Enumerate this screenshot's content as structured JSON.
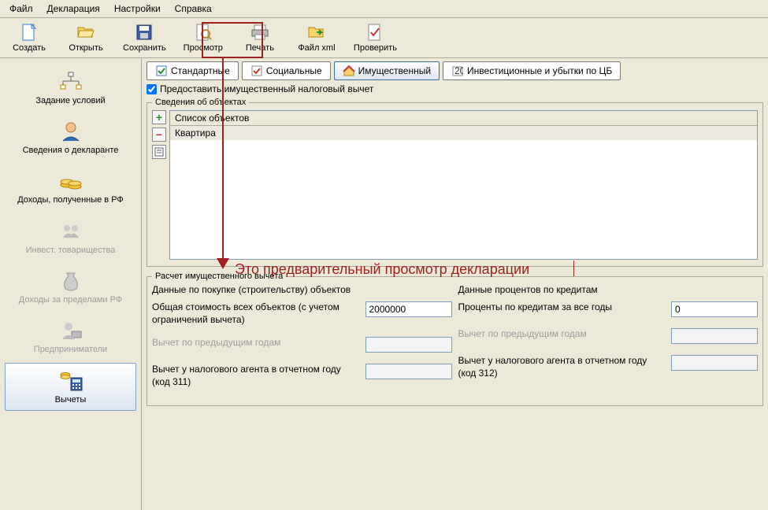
{
  "menu": {
    "file": "Файл",
    "declaration": "Декларация",
    "settings": "Настройки",
    "help": "Справка"
  },
  "toolbar": {
    "create": "Создать",
    "open": "Открыть",
    "save": "Сохранить",
    "preview": "Просмотр",
    "print": "Печать",
    "xml": "Файл xml",
    "check": "Проверить"
  },
  "sidebar": {
    "conditions": "Задание условий",
    "declarant": "Сведения о декларанте",
    "income_rf": "Доходы, полученные в РФ",
    "invest": "Инвест. товарищества",
    "income_abroad": "Доходы за пределами РФ",
    "entrepreneurs": "Предприниматели",
    "deductions": "Вычеты"
  },
  "tabs": {
    "standard": "Стандартные",
    "social": "Социальные",
    "property": "Имущественный",
    "invest_loss": "Инвестиционные и убытки по ЦБ"
  },
  "checkbox": {
    "provide": "Предоставить имущественный налоговый вычет"
  },
  "objects": {
    "legend": "Сведения об объектах",
    "header": "Список объектов",
    "rows": [
      "Квартира"
    ]
  },
  "calc": {
    "legend": "Расчет имущественного вычета",
    "left_head": "Данные по покупке (строительству) объектов",
    "right_head": "Данные процентов по кредитам",
    "total_cost_label": "Общая стоимость всех объектов (с учетом ограничений вычета)",
    "total_cost_value": "2000000",
    "interest_label": "Проценты по кредитам за все годы",
    "interest_value": "0",
    "prev_deduction_label": "Вычет по предыдущим годам",
    "agent311_label": "Вычет у налогового агента в отчетном году (код 311)",
    "agent312_label": "Вычет у налогового агента в отчетном году (код 312)"
  },
  "annotation": {
    "text": "Это предварительный просмотр декларации"
  }
}
